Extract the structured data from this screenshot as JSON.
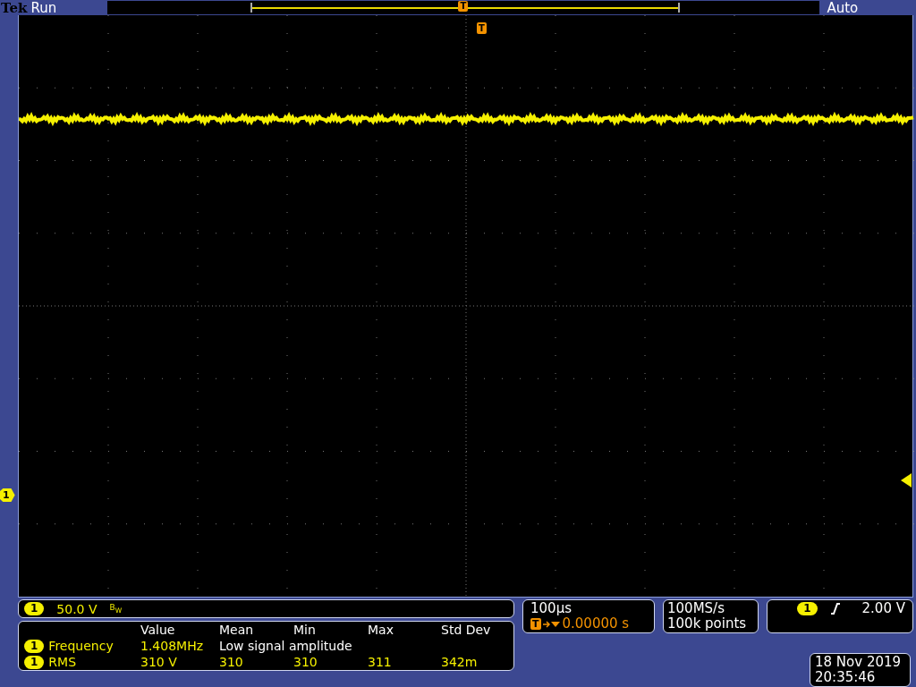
{
  "header": {
    "brand": "Tek",
    "state": "Run",
    "trigger_marker": "T",
    "trigger_mode": "Auto"
  },
  "screen": {
    "trigger_marker": "T",
    "ground_marker": "1"
  },
  "channel": {
    "number": "1",
    "scale": "50.0 V",
    "bandwidth": "B$_{W}$"
  },
  "measurements": {
    "columns": [
      "Value",
      "Mean",
      "Min",
      "Max",
      "Std Dev"
    ],
    "rows": [
      {
        "channel": "1",
        "name": "Frequency",
        "kind": "message",
        "cells": [
          "1.408MHz",
          "Low signal amplitude"
        ]
      },
      {
        "channel": "1",
        "name": "RMS",
        "kind": "stats",
        "cells": [
          "310 V",
          "310",
          "310",
          "311",
          "342m"
        ]
      }
    ]
  },
  "horizontal": {
    "scale": "100µs",
    "trigger_marker": "T",
    "delay": "0.00000 s"
  },
  "acquisition": {
    "sample_rate": "100MS/s",
    "record_length": "100k points"
  },
  "trigger": {
    "channel": "1",
    "level": "2.00 V"
  },
  "clock": {
    "date": "18 Nov 2019",
    "time": "20:35:46"
  }
}
